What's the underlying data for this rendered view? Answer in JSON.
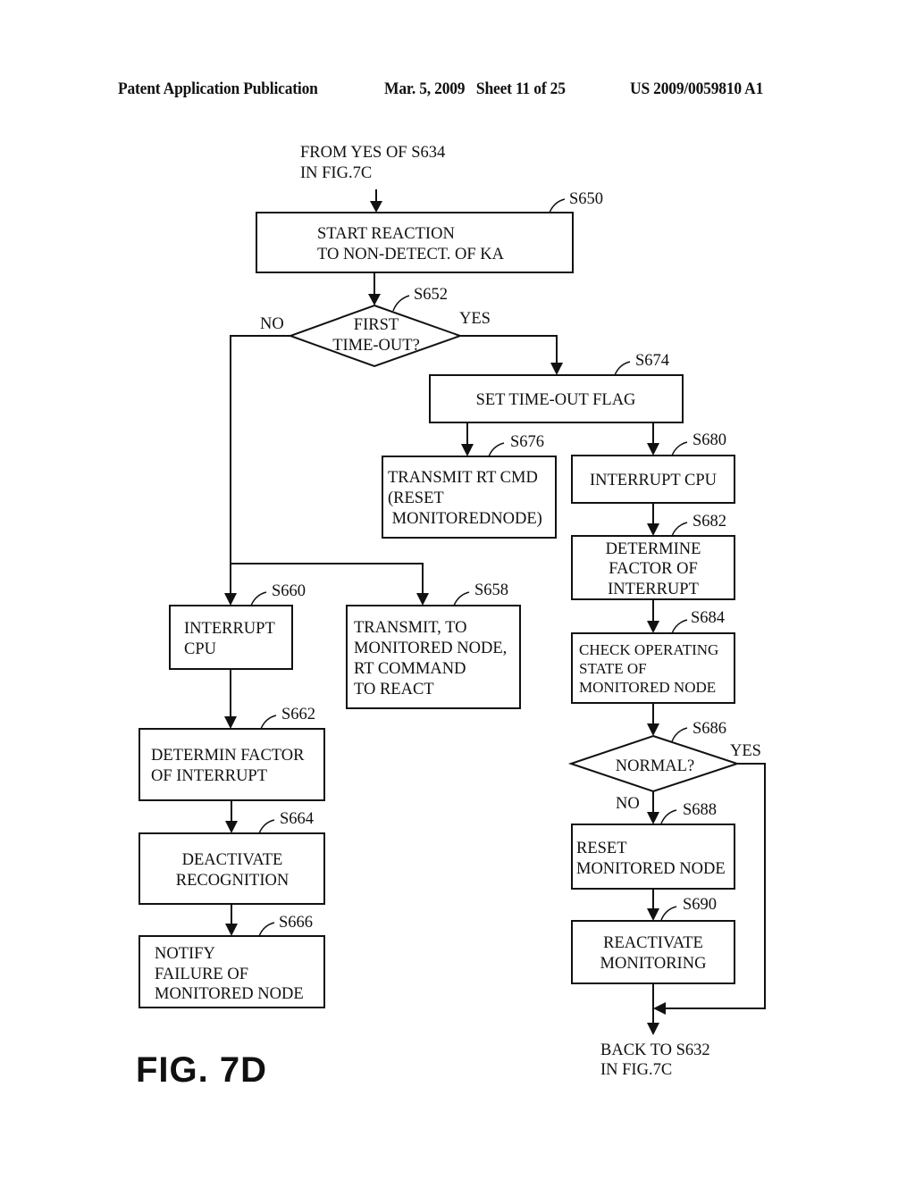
{
  "header": {
    "left": "Patent Application Publication",
    "date_sheet": "Mar. 5, 2009   Sheet 11 of 25",
    "number": "US 2009/0059810 A1"
  },
  "figure_label": "FIG. 7D",
  "flowchart": {
    "entry": [
      "FROM YES OF S634",
      "IN FIG.7C"
    ],
    "exit": [
      "BACK TO S632",
      "IN FIG.7C"
    ],
    "nodes": {
      "S650": {
        "id": "S650",
        "type": "process",
        "lines": [
          "START REACTION",
          "TO NON-DETECT. OF KA"
        ]
      },
      "S652": {
        "id": "S652",
        "type": "decision",
        "lines": [
          "FIRST",
          "TIME-OUT?"
        ],
        "yes": "YES",
        "no": "NO"
      },
      "S674": {
        "id": "S674",
        "type": "process",
        "lines": [
          "SET TIME-OUT FLAG"
        ]
      },
      "S676": {
        "id": "S676",
        "type": "process",
        "lines": [
          "TRANSMIT RT CMD",
          "(RESET",
          " MONITOREDNODE)"
        ]
      },
      "S680": {
        "id": "S680",
        "type": "process",
        "lines": [
          "INTERRUPT CPU"
        ]
      },
      "S682": {
        "id": "S682",
        "type": "process",
        "lines": [
          "DETERMINE",
          "FACTOR OF",
          "INTERRUPT"
        ]
      },
      "S684": {
        "id": "S684",
        "type": "process",
        "lines": [
          "CHECK OPERATING",
          "STATE OF",
          "MONITORED NODE"
        ]
      },
      "S686": {
        "id": "S686",
        "type": "decision",
        "lines": [
          "NORMAL?"
        ],
        "yes": "YES",
        "no": "NO"
      },
      "S688": {
        "id": "S688",
        "type": "process",
        "lines": [
          "RESET",
          "MONITORED NODE"
        ]
      },
      "S690": {
        "id": "S690",
        "type": "process",
        "lines": [
          "REACTIVATE",
          "MONITORING"
        ]
      },
      "S660": {
        "id": "S660",
        "type": "process",
        "lines": [
          "INTERRUPT",
          "CPU"
        ]
      },
      "S658": {
        "id": "S658",
        "type": "process",
        "lines": [
          "TRANSMIT, TO",
          "MONITORED NODE,",
          "RT COMMAND",
          "TO REACT"
        ]
      },
      "S662": {
        "id": "S662",
        "type": "process",
        "lines": [
          "DETERMIN FACTOR",
          "OF INTERRUPT"
        ]
      },
      "S664": {
        "id": "S664",
        "type": "process",
        "lines": [
          "DEACTIVATE",
          "RECOGNITION"
        ]
      },
      "S666": {
        "id": "S666",
        "type": "process",
        "lines": [
          "NOTIFY",
          "FAILURE OF",
          "MONITORED NODE"
        ]
      }
    },
    "edges": [
      {
        "from": "entry",
        "to": "S650"
      },
      {
        "from": "S650",
        "to": "S652"
      },
      {
        "from": "S652",
        "to": "S674",
        "label": "YES"
      },
      {
        "from": "S652",
        "to": "S660",
        "label": "NO"
      },
      {
        "from": "S652",
        "to": "S658",
        "label": "NO"
      },
      {
        "from": "S674",
        "to": "S676"
      },
      {
        "from": "S674",
        "to": "S680"
      },
      {
        "from": "S680",
        "to": "S682"
      },
      {
        "from": "S682",
        "to": "S684"
      },
      {
        "from": "S684",
        "to": "S686"
      },
      {
        "from": "S686",
        "to": "S688",
        "label": "NO"
      },
      {
        "from": "S686",
        "to": "exit",
        "label": "YES"
      },
      {
        "from": "S688",
        "to": "S690"
      },
      {
        "from": "S690",
        "to": "exit"
      },
      {
        "from": "S660",
        "to": "S662"
      },
      {
        "from": "S662",
        "to": "S664"
      },
      {
        "from": "S664",
        "to": "S666"
      }
    ]
  }
}
